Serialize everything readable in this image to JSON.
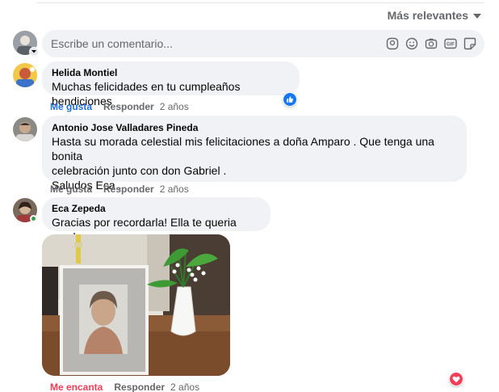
{
  "sort": {
    "label": "Más relevantes"
  },
  "composer": {
    "placeholder": "Escribe un comentario..."
  },
  "comments": [
    {
      "author": "Helida Montiel",
      "text": "Muchas felicidades en tu cumpleaños bendiciones",
      "actions": {
        "like": "Me gusta",
        "reply": "Responder",
        "time": "2 años"
      },
      "reaction": "like"
    },
    {
      "author": "Antonio Jose Valladares Pineda",
      "text": "Hasta su morada celestial mis felicitaciones a doña Amparo . Que tenga una bonita\ncelebración junto con don Gabriel .\nSaludos Eca .",
      "actions": {
        "like": "Me gusta",
        "reply": "Responder",
        "time": "2 años"
      }
    },
    {
      "author": "Eca Zepeda",
      "text": "Gracias por recordarla! Ella te queria mucho.",
      "actions": {
        "like": "Me encanta",
        "reply": "Responder",
        "time": "2 años"
      },
      "reaction": "love"
    }
  ],
  "colors": {
    "like": "#216fdb",
    "love": "#f33e58",
    "online": "#31a24c"
  }
}
